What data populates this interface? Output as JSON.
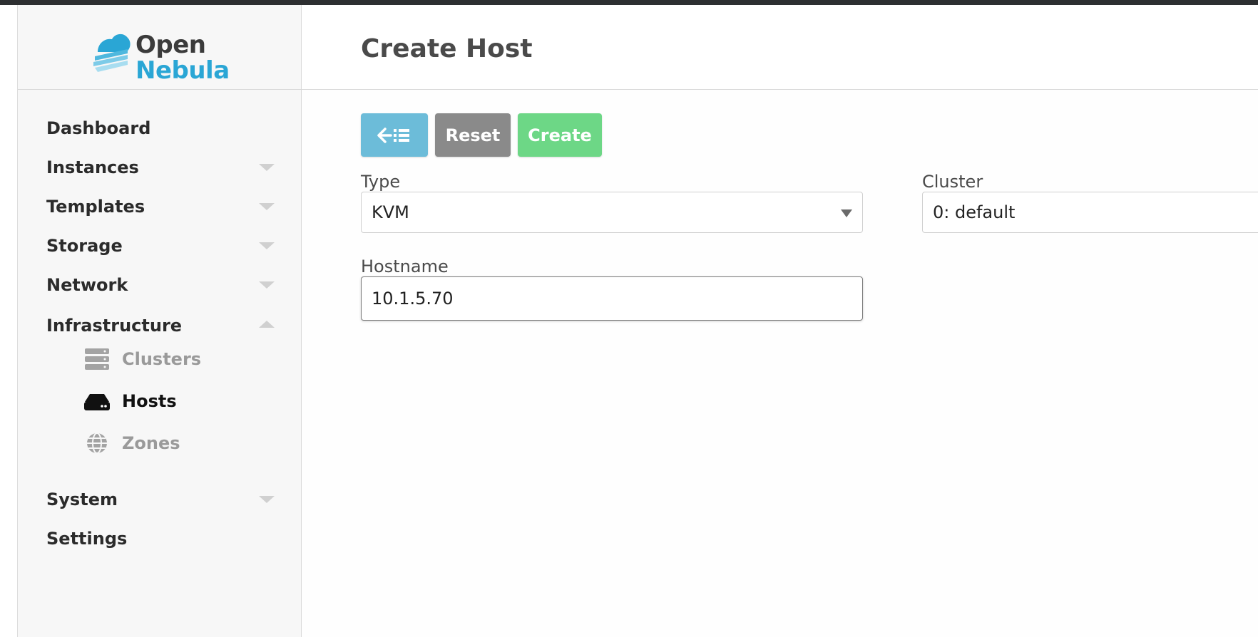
{
  "brand": {
    "logo_word_1": "Open",
    "logo_word_2": "Nebula",
    "colors": {
      "dark": "#3b3b3b",
      "accent": "#2aa6d5"
    }
  },
  "sidebar": {
    "items": [
      {
        "label": "Dashboard",
        "has_caret": false
      },
      {
        "label": "Instances",
        "has_caret": true,
        "expanded": false
      },
      {
        "label": "Templates",
        "has_caret": true,
        "expanded": false
      },
      {
        "label": "Storage",
        "has_caret": true,
        "expanded": false
      },
      {
        "label": "Network",
        "has_caret": true,
        "expanded": false
      },
      {
        "label": "Infrastructure",
        "has_caret": true,
        "expanded": true
      },
      {
        "label": "System",
        "has_caret": true,
        "expanded": false
      },
      {
        "label": "Settings",
        "has_caret": false
      }
    ],
    "infrastructure_children": [
      {
        "label": "Clusters",
        "icon": "server-stack-icon",
        "active": false
      },
      {
        "label": "Hosts",
        "icon": "hard-drive-icon",
        "active": true
      },
      {
        "label": "Zones",
        "icon": "globe-icon",
        "active": false
      }
    ]
  },
  "main": {
    "title": "Create Host",
    "toolbar": {
      "back_icon": "back-to-list-icon",
      "reset_label": "Reset",
      "create_label": "Create",
      "colors": {
        "back": "#6cbcd9",
        "reset": "#8a8a8a",
        "create": "#6dd786"
      }
    },
    "form": {
      "type_label": "Type",
      "type_value": "KVM",
      "cluster_label": "Cluster",
      "cluster_value": "0: default",
      "hostname_label": "Hostname",
      "hostname_value": "10.1.5.70"
    }
  }
}
